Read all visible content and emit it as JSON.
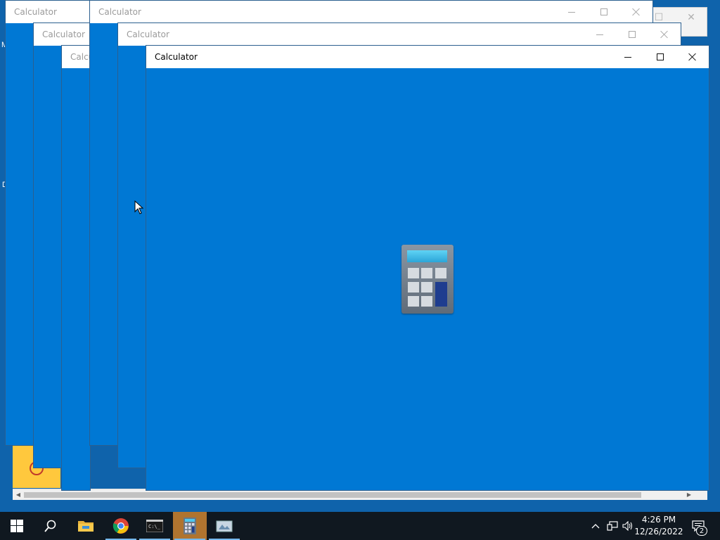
{
  "windows": [
    {
      "title": "Calculator",
      "state": "inactive"
    },
    {
      "title": "Calculator",
      "state": "inactive"
    },
    {
      "title": "Calculator",
      "state": "inactive"
    },
    {
      "title": "Calculator",
      "state": "inactive"
    },
    {
      "title": "Calculator",
      "state": "inactive"
    },
    {
      "title": "Calculator",
      "state": "active"
    }
  ],
  "partial_title": "Calcu",
  "desktop_letters": [
    "M",
    "D"
  ],
  "colors": {
    "app_background": "#0078d4",
    "desktop": "#0f63ab",
    "taskbar": "#101820",
    "active_taskbar_item": "#b0742f"
  },
  "taskbar": {
    "items": [
      {
        "name": "start",
        "icon": "windows-logo-icon"
      },
      {
        "name": "search",
        "icon": "search-icon"
      },
      {
        "name": "file-explorer",
        "icon": "folder-icon"
      },
      {
        "name": "chrome",
        "icon": "chrome-icon"
      },
      {
        "name": "command-prompt",
        "icon": "cmd-icon"
      },
      {
        "name": "calculator",
        "icon": "calculator-icon",
        "active": true
      },
      {
        "name": "other-app",
        "icon": "app-icon"
      }
    ],
    "time": "4:26 PM",
    "date": "12/26/2022",
    "notification_count": "2"
  }
}
